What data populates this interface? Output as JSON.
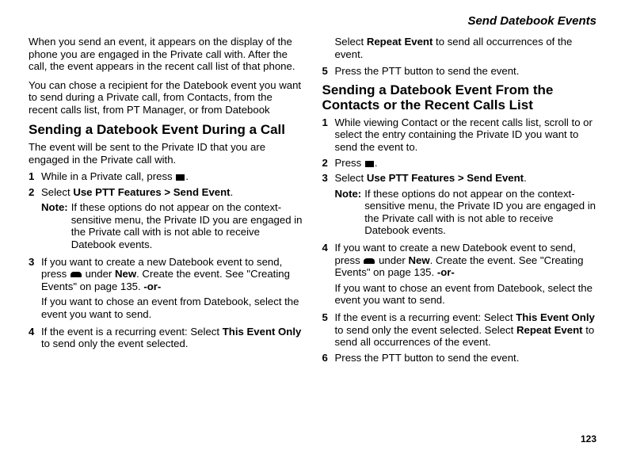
{
  "running_head": "Send Datebook Events",
  "page_number": "123",
  "left": {
    "intro1": "When you send an event, it appears on the display of the phone you are engaged in the Private call with. After the call, the event appears in the recent call list of that phone.",
    "intro2": "You can chose a recipient for the Datebook event you want to send during a Private call, from Contacts, from the recent calls list, from PT Manager, or from Datebook",
    "h_during": "Sending a Datebook Event During a Call",
    "during_lead": "The event will be sent to the Private ID that you are engaged in the Private call with.",
    "s1_num": "1",
    "s1_a": "While in a Private call, press ",
    "s1_b": ".",
    "s2_num": "2",
    "s2_a": "Select ",
    "s2_bold": "Use PTT Features > Send Event",
    "s2_b": ".",
    "note_lbl": "Note:",
    "note_txt": "If these options do not appear on the context-sensitive menu, the Private ID you are engaged in the Private call with is not able to receive Datebook events.",
    "s3_num": "3",
    "s3_a": "If you want to create a new Datebook event to send, press ",
    "s3_b": " under ",
    "s3_bold_new": "New",
    "s3_c": ". Create the event. See \"Creating Events\" on page 135. ",
    "s3_or": "-or-",
    "s3_sub": "If you want to chose an event from Datebook, select the event you want to send.",
    "s4_num": "4",
    "s4_a": "If the event is a recurring event: Select ",
    "s4_bold_this": "This Event Only",
    "s4_b": " to send only the event selected."
  },
  "right": {
    "cont_a": "Select ",
    "cont_bold": "Repeat Event",
    "cont_b": " to send all occurrences of the event.",
    "s5_num": "5",
    "s5_txt": "Press the PTT button to send the event.",
    "h_from": "Sending a Datebook Event From the Contacts or the Recent Calls List",
    "s1_num": "1",
    "s1_txt": "While viewing Contact or the recent calls list, scroll to or select the entry containing the Private ID you want to send the event to.",
    "s2_num": "2",
    "s2_a": "Press ",
    "s2_b": ".",
    "s3_num": "3",
    "s3_a": "Select ",
    "s3_bold": "Use PTT Features > Send Event",
    "s3_b": ".",
    "note_lbl": "Note:",
    "note_txt": "If these options do not appear on the context-sensitive menu, the Private ID you are engaged in the Private call with is not able to receive Datebook events.",
    "s4_num": "4",
    "s4_a": "If you want to create a new Datebook event to send, press ",
    "s4_b": " under ",
    "s4_bold_new": "New",
    "s4_c": ". Create the event. See \"Creating Events\" on page 135. ",
    "s4_or": "-or-",
    "s4_sub": "If you want to chose an event from Datebook, select the event you want to send.",
    "s5b_num": "5",
    "s5b_a": "If the event is a recurring event: Select ",
    "s5b_bold_this": "This Event Only",
    "s5b_b": " to send only the event selected. Select ",
    "s5b_bold_rep": "Repeat Event",
    "s5b_c": " to send all occurrences of the event.",
    "s6_num": "6",
    "s6_txt": "Press the PTT button to send the event."
  }
}
